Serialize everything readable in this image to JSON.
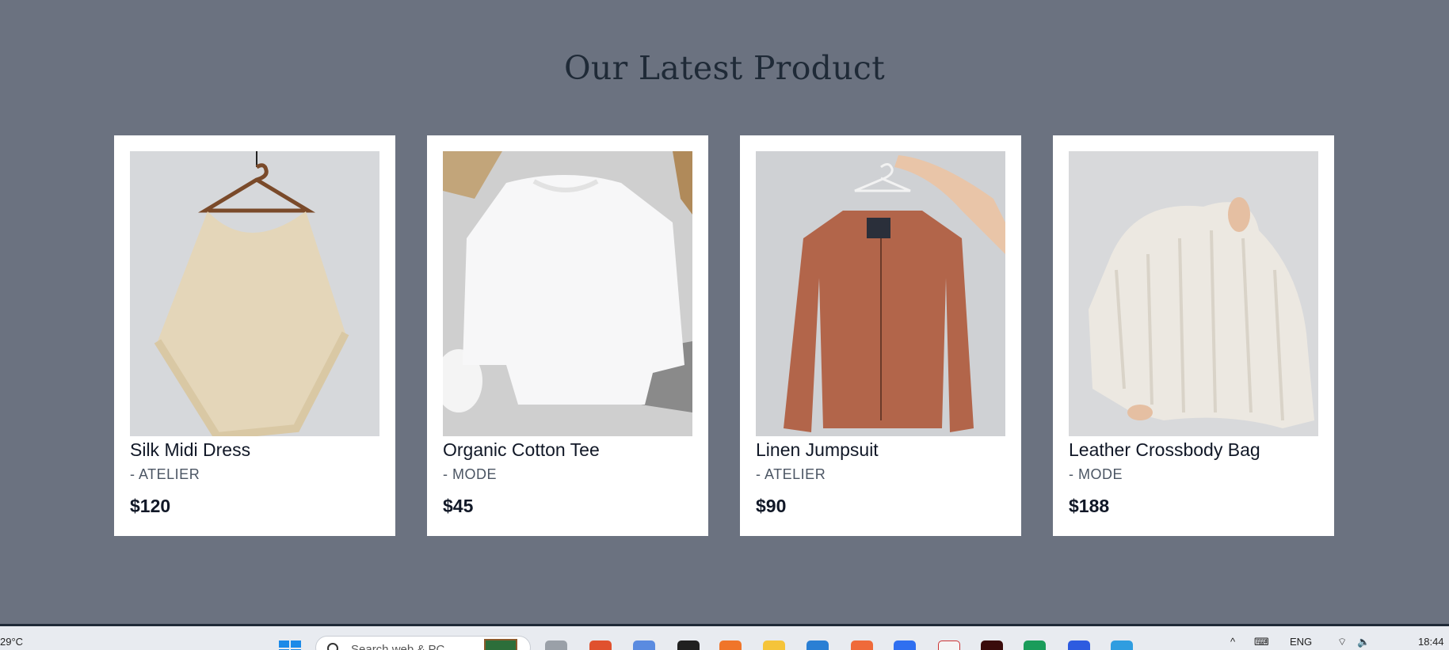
{
  "page": {
    "title": "Our Latest Product"
  },
  "products": [
    {
      "name": "Silk Midi Dress",
      "brand": "- ATELIER",
      "price": "$120",
      "image": "beige-knit-poncho-on-hanger"
    },
    {
      "name": "Organic Cotton Tee",
      "brand": "- MODE",
      "price": "$45",
      "image": "white-sweatshirt-flatlay"
    },
    {
      "name": "Linen Jumpsuit",
      "brand": "- ATELIER",
      "price": "$90",
      "image": "rust-bomber-jacket-on-hanger"
    },
    {
      "name": "Leather Crossbody Bag",
      "brand": "- MODE",
      "price": "$188",
      "image": "cream-knit-sweater"
    }
  ],
  "taskbar": {
    "weather": "29°C",
    "search_placeholder": "Search web & PC",
    "language": "ENG",
    "time": "18:44",
    "apps": [
      "brave-icon",
      "copilot-icon",
      "obs-icon",
      "firefox-icon",
      "file-explorer-icon",
      "vscode-icon",
      "git-icon",
      "messenger-icon",
      "pdf-icon",
      "illustrator-icon",
      "whatsapp-icon",
      "zoom-icon",
      "telegram-icon"
    ]
  },
  "colors": {
    "background": "#6b7280",
    "card": "#ffffff",
    "title": "#1f2a37"
  }
}
